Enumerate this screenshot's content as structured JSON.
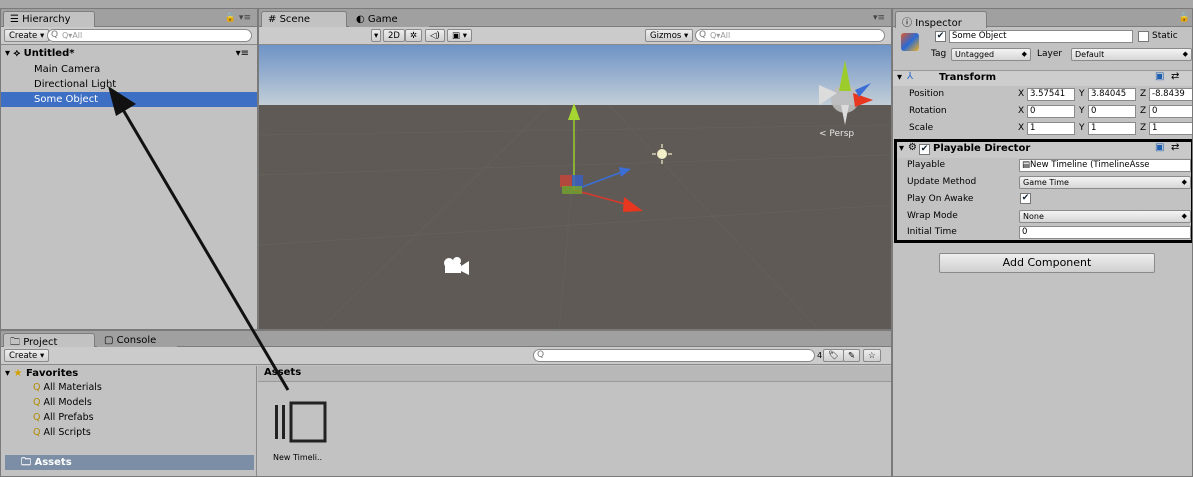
{
  "hierarchy": {
    "tab": "Hierarchy",
    "create": "Create",
    "search": "Q▾All",
    "scene_name": "Untitled*",
    "items": [
      "Main Camera",
      "Directional Light",
      "Some Object"
    ]
  },
  "scene": {
    "tabs": [
      "Scene",
      "Game"
    ],
    "shading": "Shaded",
    "mode_2d": "2D",
    "gizmos": "Gizmos",
    "search": "Q▾All",
    "persp": "< Persp"
  },
  "inspector": {
    "tab": "Inspector",
    "object_name": "Some Object",
    "static_label": "Static",
    "tag_label": "Tag",
    "tag_value": "Untagged",
    "layer_label": "Layer",
    "layer_value": "Default",
    "transform": {
      "title": "Transform",
      "rows": [
        {
          "label": "Position",
          "x": "3.57541",
          "y": "3.84045",
          "z": "-8.8439"
        },
        {
          "label": "Rotation",
          "x": "0",
          "y": "0",
          "z": "0"
        },
        {
          "label": "Scale",
          "x": "1",
          "y": "1",
          "z": "1"
        }
      ]
    },
    "playable_director": {
      "title": "Playable Director",
      "playable_label": "Playable",
      "playable_value": "New Timeline (TimelineAsse",
      "update_label": "Update Method",
      "update_value": "Game Time",
      "awake_label": "Play On Awake",
      "wrap_label": "Wrap Mode",
      "wrap_value": "None",
      "initial_label": "Initial Time",
      "initial_value": "0"
    },
    "add_component": "Add Component"
  },
  "project": {
    "tabs": [
      "Project",
      "Console"
    ],
    "create": "Create",
    "favorites": "Favorites",
    "fav_items": [
      "All Materials",
      "All Models",
      "All Prefabs",
      "All Scripts"
    ],
    "assets_folder": "Assets",
    "assets_header": "Assets",
    "asset_name": "New Timeli..",
    "count": "4"
  },
  "colors": {
    "selection": "#3d6fc4",
    "scene_sky": "#8fb2d8",
    "scene_ground": "#5f5a55",
    "highlight_box": "#000000"
  }
}
